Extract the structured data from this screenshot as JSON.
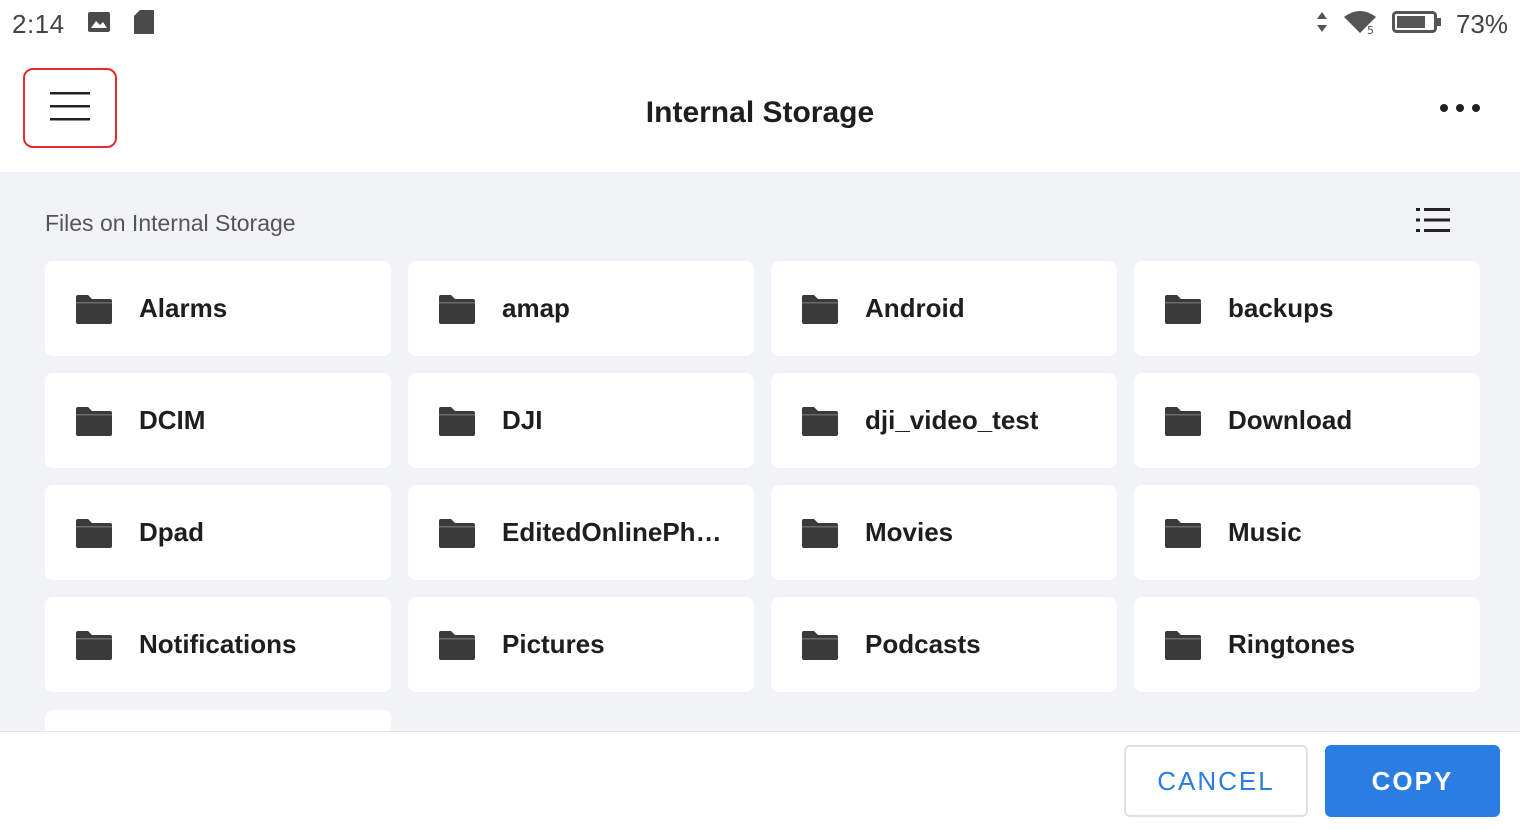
{
  "status_bar": {
    "time": "2:14",
    "battery": "73%",
    "icons": [
      "image-icon",
      "sd-card-icon",
      "data-arrows-icon",
      "wifi-icon",
      "battery-icon"
    ]
  },
  "app_bar": {
    "title": "Internal Storage",
    "menu_icon": "hamburger-menu-icon",
    "more_icon": "more-dots-icon",
    "highlight_color": "#e32b2b"
  },
  "content": {
    "section_header": "Files on Internal Storage",
    "view_toggle_icon": "list-view-icon",
    "folders": [
      {
        "label": "Alarms"
      },
      {
        "label": "amap"
      },
      {
        "label": "Android"
      },
      {
        "label": "backups"
      },
      {
        "label": "DCIM"
      },
      {
        "label": "DJI"
      },
      {
        "label": "dji_video_test"
      },
      {
        "label": "Download"
      },
      {
        "label": "Dpad"
      },
      {
        "label": "EditedOnlinePh…"
      },
      {
        "label": "Movies"
      },
      {
        "label": "Music"
      },
      {
        "label": "Notifications"
      },
      {
        "label": "Pictures"
      },
      {
        "label": "Podcasts"
      },
      {
        "label": "Ringtones"
      }
    ]
  },
  "actions": {
    "cancel_label": "CANCEL",
    "copy_label": "COPY",
    "accent_color": "#2a7de1"
  }
}
